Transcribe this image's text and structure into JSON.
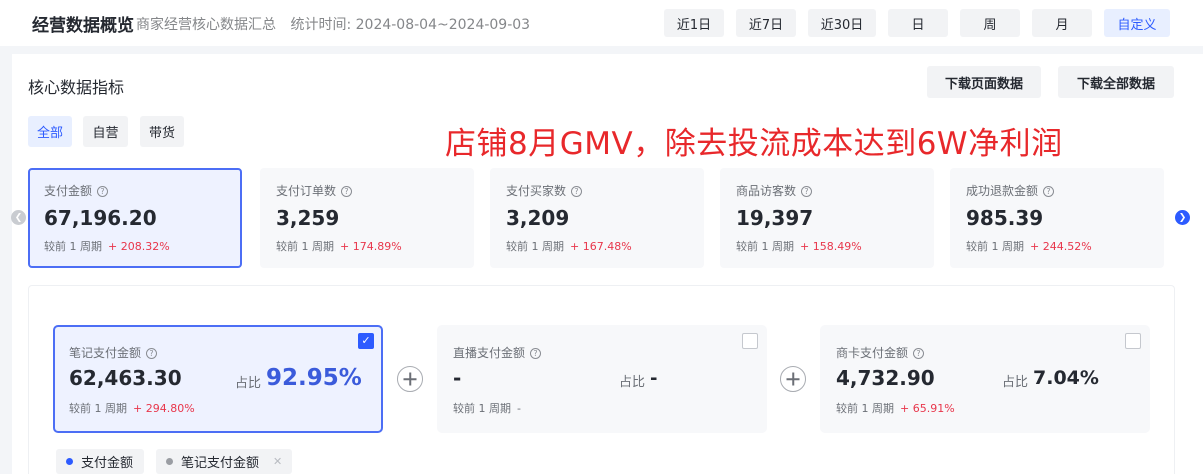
{
  "header": {
    "title": "经营数据概览",
    "subtitle": "商家经营核心数据汇总",
    "stat_time_label": "统计时间:",
    "stat_time_range": "2024-08-04~2024-09-03",
    "range_buttons": [
      {
        "label": "近1日",
        "active": false
      },
      {
        "label": "近7日",
        "active": false
      },
      {
        "label": "近30日",
        "active": false
      },
      {
        "label": "日",
        "active": false
      },
      {
        "label": "周",
        "active": false
      },
      {
        "label": "月",
        "active": false
      },
      {
        "label": "自定义",
        "active": true
      }
    ]
  },
  "core": {
    "title": "核心数据指标",
    "download_page": "下载页面数据",
    "download_all": "下载全部数据",
    "filters": [
      {
        "label": "全部",
        "active": true
      },
      {
        "label": "自营",
        "active": false
      },
      {
        "label": "带货",
        "active": false
      }
    ],
    "overlay_text": "店铺8月GMV，除去投流成本达到6W净利润",
    "compare_label": "较前 1 周期",
    "metrics": [
      {
        "label": "支付金额",
        "value": "67,196.20",
        "change": "+ 208.32%",
        "selected": true
      },
      {
        "label": "支付订单数",
        "value": "3,259",
        "change": "+ 174.89%",
        "selected": false
      },
      {
        "label": "支付买家数",
        "value": "3,209",
        "change": "+ 167.48%",
        "selected": false
      },
      {
        "label": "商品访客数",
        "value": "19,397",
        "change": "+ 158.49%",
        "selected": false
      },
      {
        "label": "成功退款金额",
        "value": "985.39",
        "change": "+ 244.52%",
        "selected": false
      }
    ]
  },
  "breakdown": {
    "ratio_label": "占比",
    "compare_label": "较前 1 周期",
    "cards": [
      {
        "label": "笔记支付金额",
        "value": "62,463.30",
        "ratio": "92.95%",
        "change": "+ 294.80%",
        "checked": true
      },
      {
        "label": "直播支付金额",
        "value": "-",
        "ratio": "-",
        "change": "-",
        "checked": false
      },
      {
        "label": "商卡支付金额",
        "value": "4,732.90",
        "ratio": "7.04%",
        "change": "+ 65.91%",
        "checked": false
      }
    ],
    "legend": [
      {
        "label": "支付金额",
        "color": "#2d5bff"
      },
      {
        "label": "笔记支付金额",
        "color": "#9a9da3",
        "closable": true
      }
    ]
  },
  "colors": {
    "accent": "#2d5bff",
    "selected_border": "#4c6ef5",
    "increase": "#e8364b",
    "overlay": "#e8282b"
  }
}
